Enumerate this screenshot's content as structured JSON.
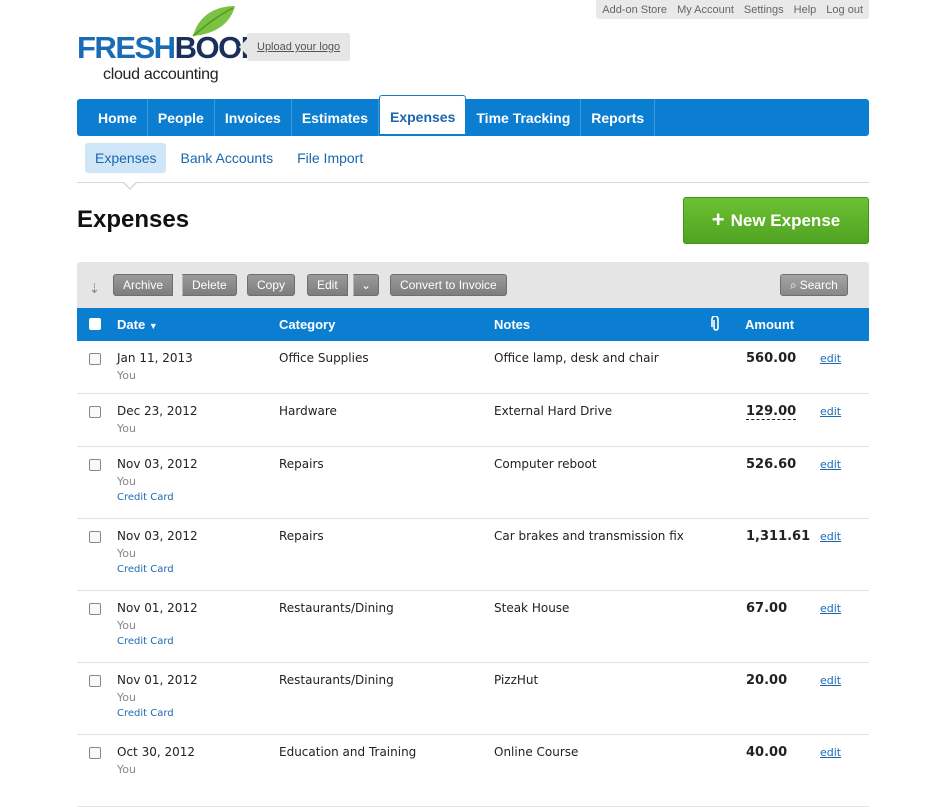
{
  "top_links": [
    "Add-on Store",
    "My Account",
    "Settings",
    "Help",
    "Log out"
  ],
  "logo": {
    "fresh": "FRESH",
    "books": "BOOKS",
    "tagline": "cloud accounting"
  },
  "upload_logo": "Upload your logo",
  "main_nav": [
    "Home",
    "People",
    "Invoices",
    "Estimates",
    "Expenses",
    "Time Tracking",
    "Reports"
  ],
  "main_nav_active": "Expenses",
  "sub_nav": [
    "Expenses",
    "Bank Accounts",
    "File Import"
  ],
  "sub_nav_active": "Expenses",
  "page_title": "Expenses",
  "new_expense_label": "New Expense",
  "toolbar": {
    "archive": "Archive",
    "delete": "Delete",
    "copy": "Copy",
    "edit": "Edit",
    "convert": "Convert to Invoice",
    "search": "Search"
  },
  "columns": {
    "date": "Date",
    "date_sort": "▼",
    "category": "Category",
    "notes": "Notes",
    "amount": "Amount"
  },
  "rows": [
    {
      "date": "Jan 11, 2013",
      "who": "You",
      "account": "",
      "category": "Office Supplies",
      "notes": "Office lamp, desk and chair",
      "amount": "560.00",
      "edit": "edit"
    },
    {
      "date": "Dec 23, 2012",
      "who": "You",
      "account": "",
      "category": "Hardware",
      "notes": "External Hard Drive",
      "amount": "129.00",
      "edit": "edit"
    },
    {
      "date": "Nov 03, 2012",
      "who": "You",
      "account": "Credit Card",
      "category": "Repairs",
      "notes": "Computer reboot",
      "amount": "526.60",
      "edit": "edit"
    },
    {
      "date": "Nov 03, 2012",
      "who": "You",
      "account": "Credit Card",
      "category": "Repairs",
      "notes": "Car brakes and transmission fix",
      "amount": "1,311.61",
      "edit": "edit"
    },
    {
      "date": "Nov 01, 2012",
      "who": "You",
      "account": "Credit Card",
      "category": "Restaurants/Dining",
      "notes": "Steak House",
      "amount": "67.00",
      "edit": "edit"
    },
    {
      "date": "Nov 01, 2012",
      "who": "You",
      "account": "Credit Card",
      "category": "Restaurants/Dining",
      "notes": "PizzHut",
      "amount": "20.00",
      "edit": "edit"
    },
    {
      "date": "Oct 30, 2012",
      "who": "You",
      "account": "",
      "category": "Education and Training",
      "notes": "Online Course",
      "amount": "40.00",
      "edit": "edit"
    }
  ],
  "colors": {
    "nav_blue": "#0c7ed1",
    "link_blue": "#1a6bb5",
    "green": "#5bb22a",
    "subnav_active_bg": "#cfe6f8"
  }
}
